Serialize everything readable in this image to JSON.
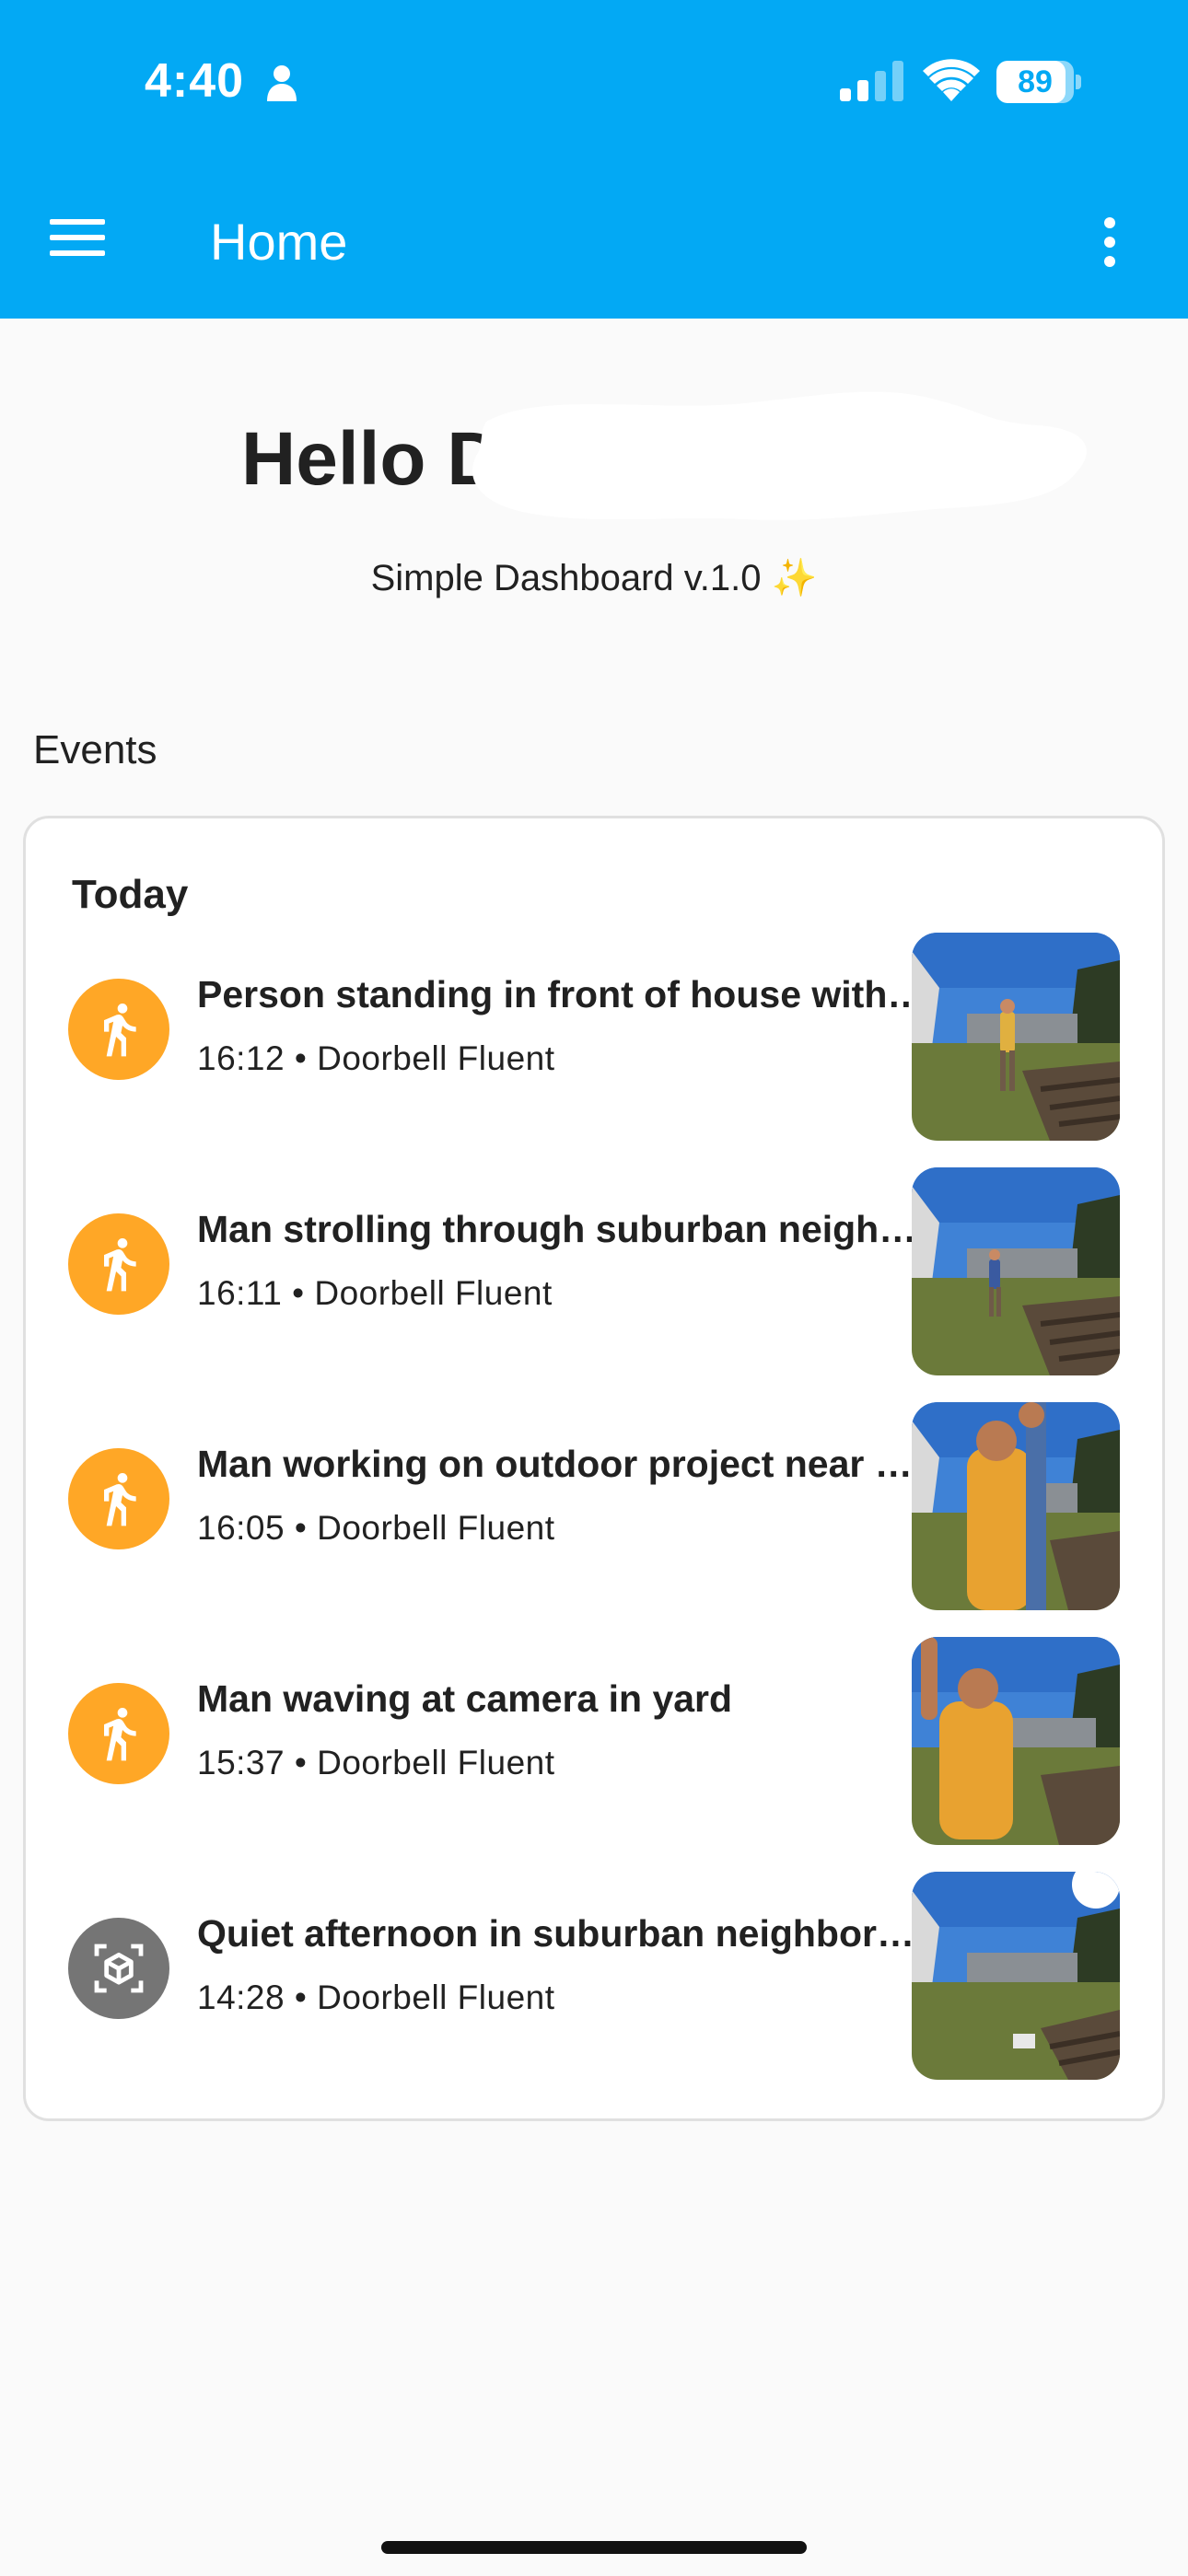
{
  "status_bar": {
    "time": "4:40",
    "battery_level": "89",
    "battery_fraction": 0.89
  },
  "app_bar": {
    "title": "Home",
    "menu_icon": "hamburger-menu-icon",
    "more_icon": "more-vert-icon",
    "background_color": "#03a9f4"
  },
  "greeting": {
    "text": "Hello D"
  },
  "subtitle": {
    "text": "Simple Dashboard v.1.0",
    "emoji": "✨"
  },
  "events_section": {
    "label": "Events",
    "day_heading": "Today",
    "items": [
      {
        "title": "Person standing in front of house with …",
        "time": "16:12",
        "source": "Doorbell Fluent",
        "icon": "walk-icon",
        "icon_color": "#ffa726"
      },
      {
        "title": "Man strolling through suburban neighb…",
        "time": "16:11",
        "source": "Doorbell Fluent",
        "icon": "walk-icon",
        "icon_color": "#ffa726"
      },
      {
        "title": "Man working on outdoor project near h…",
        "time": "16:05",
        "source": "Doorbell Fluent",
        "icon": "walk-icon",
        "icon_color": "#ffa726"
      },
      {
        "title": "Man waving at camera in yard",
        "time": "15:37",
        "source": "Doorbell Fluent",
        "icon": "walk-icon",
        "icon_color": "#ffa726"
      },
      {
        "title": "Quiet afternoon in suburban neighborh…",
        "time": "14:28",
        "source": "Doorbell Fluent",
        "icon": "cube-scan-icon",
        "icon_color": "#757575"
      }
    ],
    "separator": " • "
  }
}
